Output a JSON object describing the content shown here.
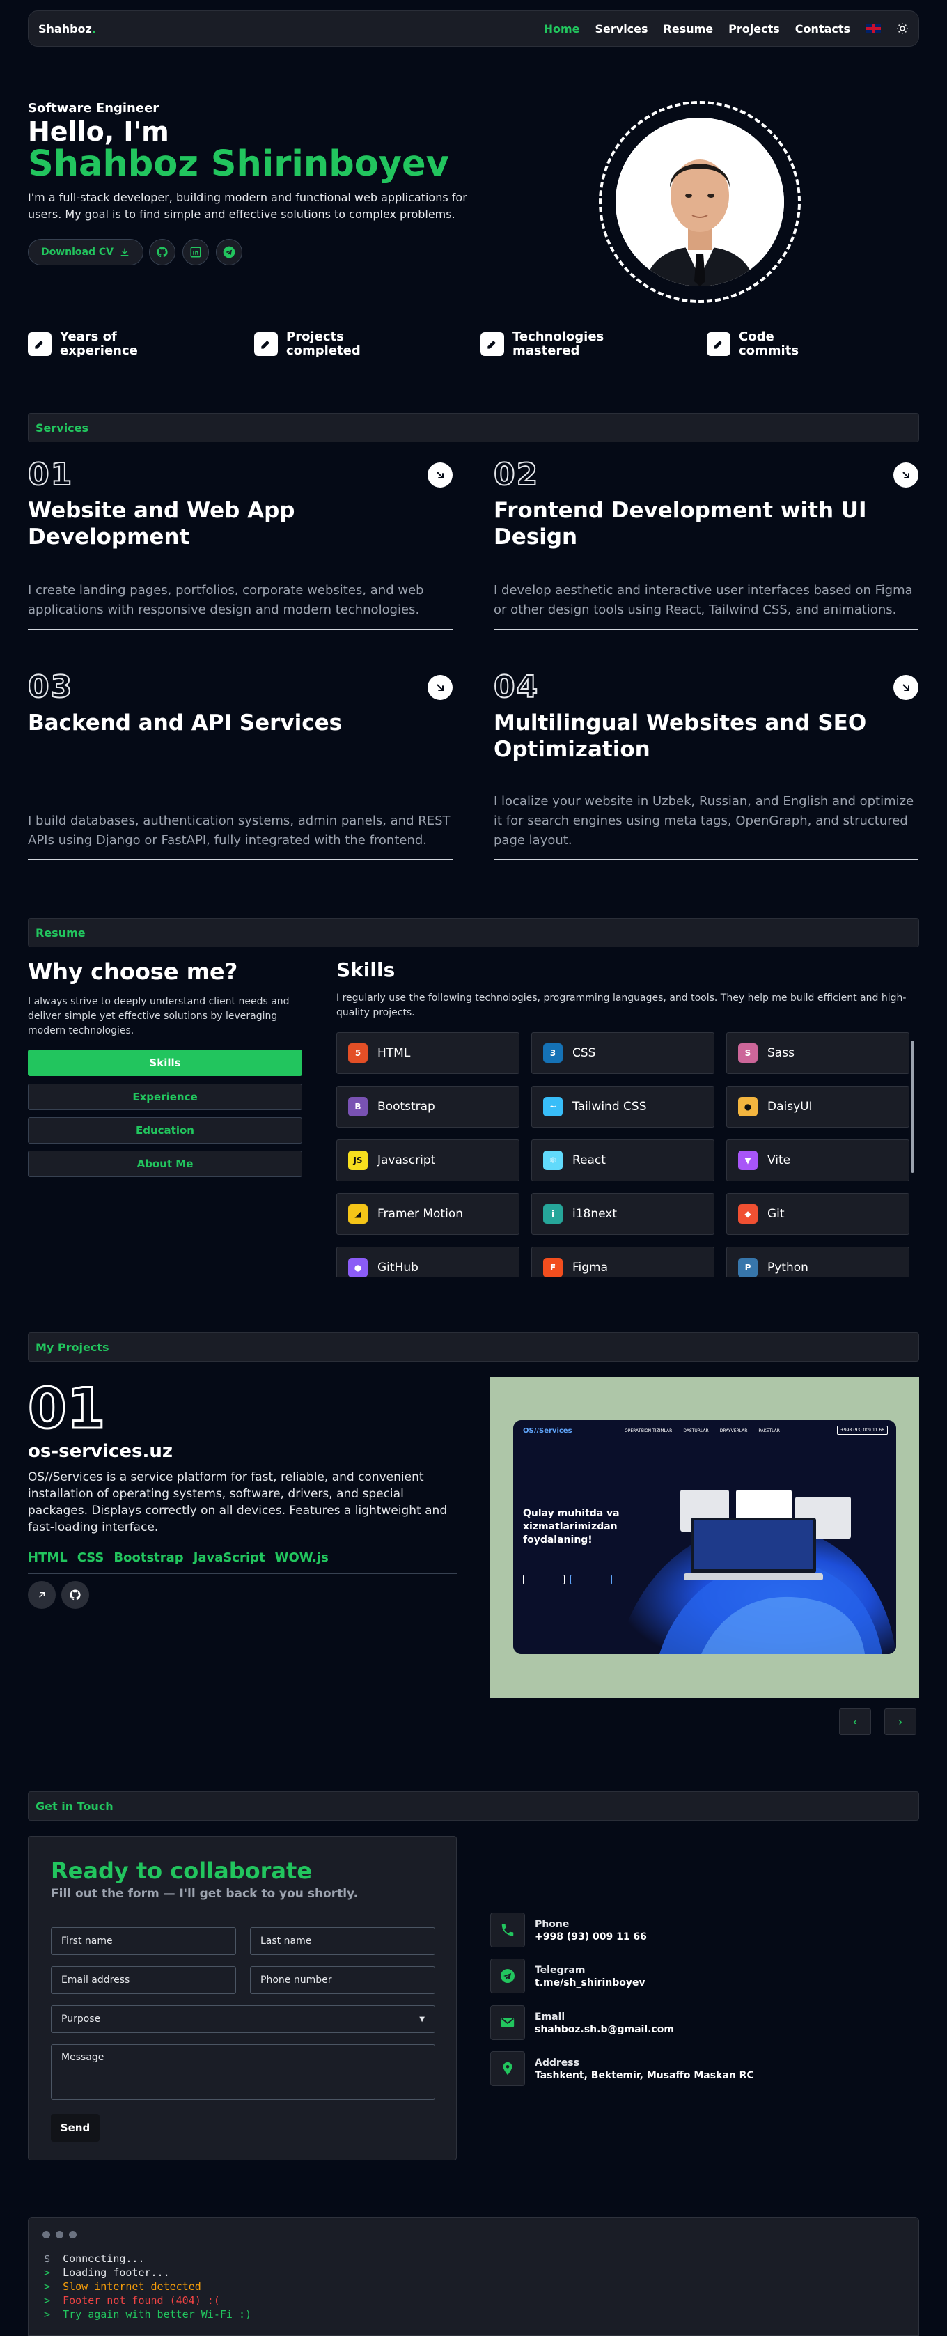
{
  "nav": {
    "logo": "Shahboz",
    "logo_dot": ".",
    "links": [
      "Home",
      "Services",
      "Resume",
      "Projects",
      "Contacts"
    ],
    "active": "Home"
  },
  "hero": {
    "subtitle": "Software Engineer",
    "greeting": "Hello, I'm",
    "name": "Shahboz Shirinboyev",
    "description": "I'm a full-stack developer, building modern and functional web applications for users. My goal is to find simple and effective solutions to complex problems.",
    "cv_button": "Download CV"
  },
  "stats": [
    {
      "line1": "Years of",
      "line2": "experience"
    },
    {
      "line1": "Projects",
      "line2": "completed"
    },
    {
      "line1": "Technologies",
      "line2": "mastered"
    },
    {
      "line1": "Code",
      "line2": "commits"
    }
  ],
  "services": {
    "header": "Services",
    "items": [
      {
        "num": "01",
        "title": "Website and Web App Development",
        "desc": "I create landing pages, portfolios, corporate websites, and web applications with responsive design and modern technologies."
      },
      {
        "num": "02",
        "title": "Frontend Development with UI Design",
        "desc": "I develop aesthetic and interactive user interfaces based on Figma or other design tools using React, Tailwind CSS, and animations."
      },
      {
        "num": "03",
        "title": "Backend and API Services",
        "desc": "I build databases, authentication systems, admin panels, and REST APIs using Django or FastAPI, fully integrated with the frontend."
      },
      {
        "num": "04",
        "title": "Multilingual Websites and SEO Optimization",
        "desc": "I localize your website in Uzbek, Russian, and English and optimize it for search engines using meta tags, OpenGraph, and structured page layout."
      }
    ]
  },
  "resume": {
    "header": "Resume",
    "why_title": "Why choose me?",
    "why_desc": "I always strive to deeply understand client needs and deliver simple yet effective solutions by leveraging modern technologies.",
    "tabs": [
      "Skills",
      "Experience",
      "Education",
      "About Me"
    ],
    "skills_title": "Skills",
    "skills_desc": "I regularly use the following technologies, programming languages, and tools. They help me build efficient and high-quality projects.",
    "skills": [
      {
        "name": "HTML",
        "icon": "html5-icon",
        "color": "#e34f26",
        "glyph": "5"
      },
      {
        "name": "CSS",
        "icon": "css3-icon",
        "color": "#1572b6",
        "glyph": "3"
      },
      {
        "name": "Sass",
        "icon": "sass-icon",
        "color": "#cc6699",
        "glyph": "S"
      },
      {
        "name": "Bootstrap",
        "icon": "bootstrap-icon",
        "color": "#7952b3",
        "glyph": "B"
      },
      {
        "name": "Tailwind CSS",
        "icon": "tailwind-icon",
        "color": "#38bdf8",
        "glyph": "~"
      },
      {
        "name": "DaisyUI",
        "icon": "daisyui-icon",
        "color": "#f3b53f",
        "glyph": "●"
      },
      {
        "name": "Javascript",
        "icon": "javascript-icon",
        "color": "#f7df1e",
        "glyph": "JS"
      },
      {
        "name": "React",
        "icon": "react-icon",
        "color": "#61dafb",
        "glyph": "⚛"
      },
      {
        "name": "Vite",
        "icon": "vite-icon",
        "color": "#a855f7",
        "glyph": "▼"
      },
      {
        "name": "Framer Motion",
        "icon": "framer-motion-icon",
        "color": "#f5c518",
        "glyph": "◢"
      },
      {
        "name": "i18next",
        "icon": "i18next-icon",
        "color": "#26a69a",
        "glyph": "i"
      },
      {
        "name": "Git",
        "icon": "git-icon",
        "color": "#f05032",
        "glyph": "◆"
      },
      {
        "name": "GitHub",
        "icon": "github-icon",
        "color": "#8b5cf6",
        "glyph": "●"
      },
      {
        "name": "Figma",
        "icon": "figma-icon",
        "color": "#f24e1e",
        "glyph": "F"
      },
      {
        "name": "Python",
        "icon": "python-icon",
        "color": "#3776ab",
        "glyph": "P"
      }
    ]
  },
  "projects": {
    "header": "My Projects",
    "num": "01",
    "title": "os-services.uz",
    "description": "OS//Services is a service platform for fast, reliable, and convenient installation of operating systems, software, drivers, and special packages. Displays correctly on all devices. Features a lightweight and fast-loading interface.",
    "tags": [
      "HTML",
      "CSS",
      "Bootstrap",
      "JavaScript",
      "WOW.js"
    ],
    "preview": {
      "brand": "OS//Services",
      "menu": [
        "OPERATSION TIZIMLAR",
        "DASTURLAR",
        "DRAYVERLAR",
        "PAKETLAR"
      ],
      "phone": "+998 (93) 009 11 66",
      "headline_1": "Qulay muhitda va",
      "headline_2": "xizmatlarimizdan",
      "headline_3": "foydalaning!"
    }
  },
  "contact": {
    "header": "Get in Touch",
    "form_title": "Ready to collaborate",
    "form_sub": "Fill out the form — I'll get back to you shortly.",
    "placeholders": {
      "first": "First name",
      "last": "Last name",
      "email": "Email address",
      "phone": "Phone number",
      "purpose": "Purpose",
      "message": "Message"
    },
    "send": "Send",
    "info": [
      {
        "label": "Phone",
        "value": "+998 (93) 009 11 66",
        "icon": "phone-icon"
      },
      {
        "label": "Telegram",
        "value": "t.me/sh_shirinboyev",
        "icon": "telegram-icon"
      },
      {
        "label": "Email",
        "value": "shahboz.sh.b@gmail.com",
        "icon": "mail-icon"
      },
      {
        "label": "Address",
        "value": "Tashkent, Bektemir, Musaffo Maskan RC",
        "icon": "map-pin-icon"
      }
    ]
  },
  "terminal": {
    "lines": [
      {
        "prefix": "$",
        "text": "Connecting...",
        "color": "#e5e7eb"
      },
      {
        "prefix": ">",
        "text": "Loading footer...",
        "color": "#e5e7eb"
      },
      {
        "prefix": ">",
        "text": "Slow internet detected",
        "color": "#f59e0b"
      },
      {
        "prefix": ">",
        "text": "Footer not found (404) :(",
        "color": "#ef4444"
      },
      {
        "prefix": ">",
        "text": "Try again with better Wi-Fi :)",
        "color": "#22c55e"
      }
    ]
  },
  "colors": {
    "accent": "#22c55e",
    "background": "#050a16",
    "card": "#1a1d26"
  }
}
